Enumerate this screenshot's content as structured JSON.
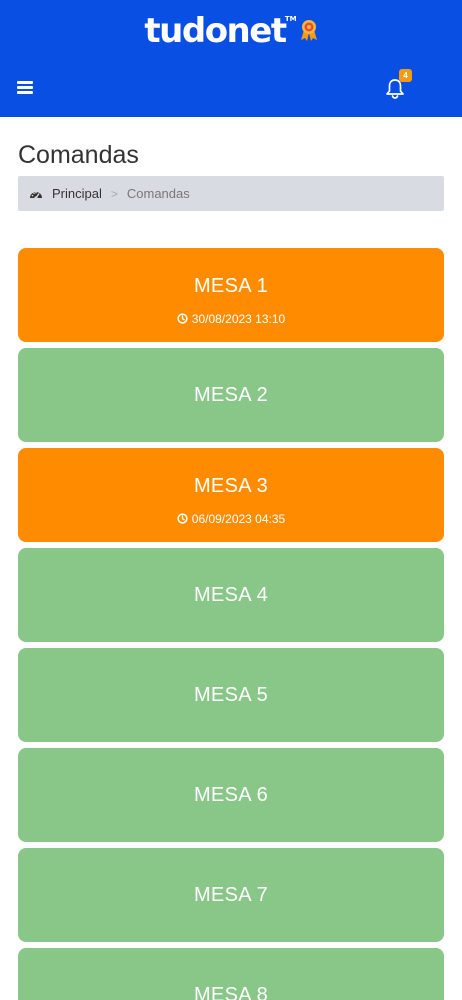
{
  "header": {
    "logo": "tudonet",
    "logo_tm": "TM",
    "award_icon": "award-ribbon-icon",
    "menu_icon": "hamburger-menu-icon",
    "bell_icon": "bell-icon",
    "notification_count": "4",
    "colors": {
      "bar": "#0a4fe3",
      "badge": "#f39c12"
    }
  },
  "page": {
    "title": "Comandas"
  },
  "breadcrumb": {
    "home_icon": "dashboard-icon",
    "home_label": "Principal",
    "separator": ">",
    "current": "Comandas"
  },
  "mesas": [
    {
      "name": "MESA 1",
      "status": "busy",
      "time": "30/08/2023 13:10"
    },
    {
      "name": "MESA 2",
      "status": "free"
    },
    {
      "name": "MESA 3",
      "status": "busy",
      "time": "06/09/2023 04:35"
    },
    {
      "name": "MESA 4",
      "status": "free"
    },
    {
      "name": "MESA 5",
      "status": "free"
    },
    {
      "name": "MESA 6",
      "status": "free"
    },
    {
      "name": "MESA 7",
      "status": "free"
    },
    {
      "name": "MESA 8",
      "status": "free"
    }
  ],
  "colors": {
    "free": "#88c788",
    "busy": "#ff8c00"
  }
}
